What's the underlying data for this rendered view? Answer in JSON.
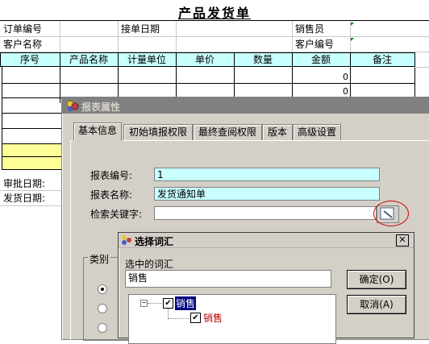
{
  "sheet": {
    "title": "产品发货单",
    "order_no_label": "订单编号",
    "order_date_label": "接单日期",
    "salesperson_label": "销售员",
    "customer_name_label": "客户名称",
    "customer_no_label": "客户编号",
    "columns": [
      "序号",
      "产品名称",
      "计量单位",
      "单价",
      "数量",
      "金额",
      "备注"
    ],
    "amount_values": [
      "0",
      "0"
    ],
    "approve_date_label": "审批日期:",
    "ship_date_label": "发货日期:"
  },
  "dialog": {
    "title": "报表属性",
    "tabs": [
      "基本信息",
      "初始填报权限",
      "最终查阅权限",
      "版本",
      "高级设置"
    ],
    "report_no_label": "报表编号:",
    "report_no_value": "1",
    "report_name_label": "报表名称:",
    "report_name_value": "发货通知单",
    "keyword_label": "检索关键字:",
    "keyword_value": "",
    "category_label": "类别"
  },
  "sub_dialog": {
    "title": "选择词汇",
    "selected_label": "选中的词汇",
    "selected_value": "销售",
    "ok_label": "确定(O)",
    "cancel_label": "取消(A)",
    "tree": {
      "root": "销售",
      "child": "销售"
    }
  },
  "colors": {
    "highlight_row": "#ffff99",
    "input_bg": "#c8ffff",
    "tree_child_text": "#c00000",
    "marker": "#cc0000"
  }
}
